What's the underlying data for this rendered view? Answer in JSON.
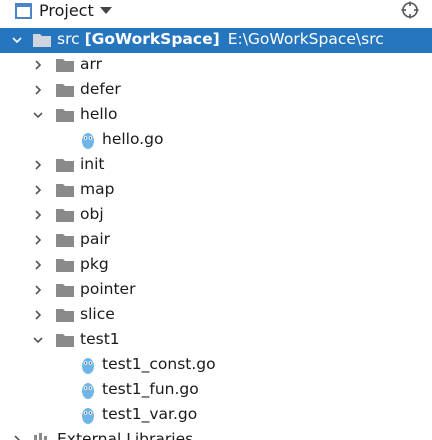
{
  "header": {
    "title": "Project",
    "proj_icon": "project-window-icon",
    "dropdown_icon": "chevron-down-icon",
    "settings_icon": "crosshair-gear-icon"
  },
  "colors": {
    "selection": "#2675bf",
    "folder": "#8a8a8a",
    "gopher": "#6fb6e6"
  },
  "tree": {
    "root": {
      "name": "src",
      "module": "[GoWorkSpace]",
      "path": "E:\\GoWorkSpace\\src"
    },
    "items": [
      {
        "label": "arr"
      },
      {
        "label": "defer"
      },
      {
        "label": "hello"
      },
      {
        "label": "hello.go"
      },
      {
        "label": "init"
      },
      {
        "label": "map"
      },
      {
        "label": "obj"
      },
      {
        "label": "pair"
      },
      {
        "label": "pkg"
      },
      {
        "label": "pointer"
      },
      {
        "label": "slice"
      },
      {
        "label": "test1"
      },
      {
        "label": "test1_const.go"
      },
      {
        "label": "test1_fun.go"
      },
      {
        "label": "test1_var.go"
      },
      {
        "label": "External Libraries"
      }
    ]
  }
}
